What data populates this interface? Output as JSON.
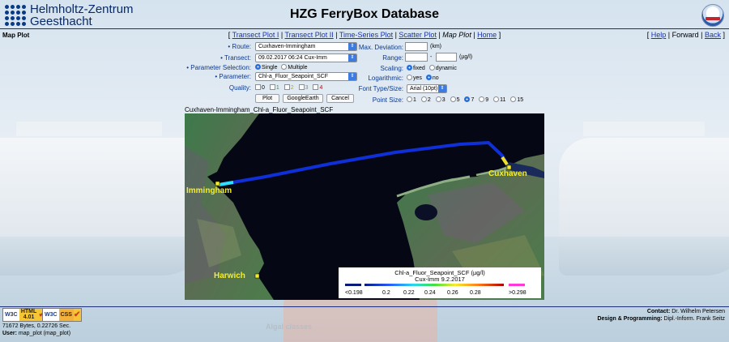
{
  "header": {
    "org_line1": "Helmholtz-Zentrum",
    "org_line2": "Geesthacht",
    "title": "HZG FerryBox Database"
  },
  "page_label": "Map Plot",
  "nav": {
    "items": [
      {
        "label": "Transect Plot I",
        "current": false
      },
      {
        "label": "Transect Plot II",
        "current": false
      },
      {
        "label": "Time-Series Plot",
        "current": false
      },
      {
        "label": "Scatter Plot",
        "current": false
      },
      {
        "label": "Map Plot",
        "current": true
      },
      {
        "label": "Home",
        "current": false
      }
    ]
  },
  "right_nav": {
    "help": "Help",
    "forward": "Forward",
    "back": "Back"
  },
  "form": {
    "route_label": "Route:",
    "route_value": "Cuxhaven-Immingham",
    "transect_label": "Transect:",
    "transect_value": "09.02.2017 06:24 Cux-Imm",
    "param_selection_label": "Parameter Selection:",
    "param_selection_options": [
      "Single",
      "Multiple"
    ],
    "param_selection_selected": "Single",
    "parameter_label": "Parameter:",
    "parameter_value": "Chl-a_Fluor_Seapoint_SCF",
    "quality_label": "Quality:",
    "quality_options": [
      "0",
      "1",
      "2",
      "3",
      "4"
    ],
    "buttons": {
      "plot": "Plot",
      "google_earth": "GoogleEarth",
      "cancel": "Cancel"
    },
    "max_deviation_label": "Max. Deviation:",
    "max_deviation_unit": "(km)",
    "range_label": "Range:",
    "range_separator": "-",
    "range_unit": "(µg/l)",
    "scaling_label": "Scaling:",
    "scaling_options": [
      "fixed",
      "dynamic"
    ],
    "scaling_selected": "fixed",
    "log_label": "Logarithmic:",
    "log_options": [
      "yes",
      "no"
    ],
    "log_selected": "no",
    "font_label": "Font Type/Size:",
    "font_value": "Arial (10pt)",
    "point_size_label": "Point Size:",
    "point_sizes": [
      "1",
      "2",
      "3",
      "5",
      "7",
      "9",
      "11",
      "15"
    ],
    "point_size_selected": "7"
  },
  "map": {
    "caption": "Cuxhaven-Immingham_Chl-a_Fluor_Seapoint_SCF",
    "cities": {
      "immingham": "Immingham",
      "cuxhaven": "Cuxhaven",
      "harwich": "Harwich"
    },
    "legend_title": "Chl-a_Fluor_Seapoint_SCF (µg/l)",
    "legend_subtitle": "Cux-Imm 9.2.2017",
    "legend_ticks": [
      "<0.198",
      "0.2",
      "0.22",
      "0.24",
      "0.26",
      "0.28",
      ">0.298"
    ]
  },
  "footer": {
    "w3c_html": "HTML 4.01",
    "w3c_css": "CSS",
    "w3c": "W3C",
    "stats": "71672 Bytes, 0.22726 Sec.",
    "user_label": "User:",
    "user_value": "map_plot (map_plot)",
    "contact_label": "Contact:",
    "contact_name": "Dr. Wilhelm Petersen",
    "design_label": "Design & Programming:",
    "design_name": "Dipl.-Inform. Frank Seitz"
  },
  "watermark": "Algal classes"
}
